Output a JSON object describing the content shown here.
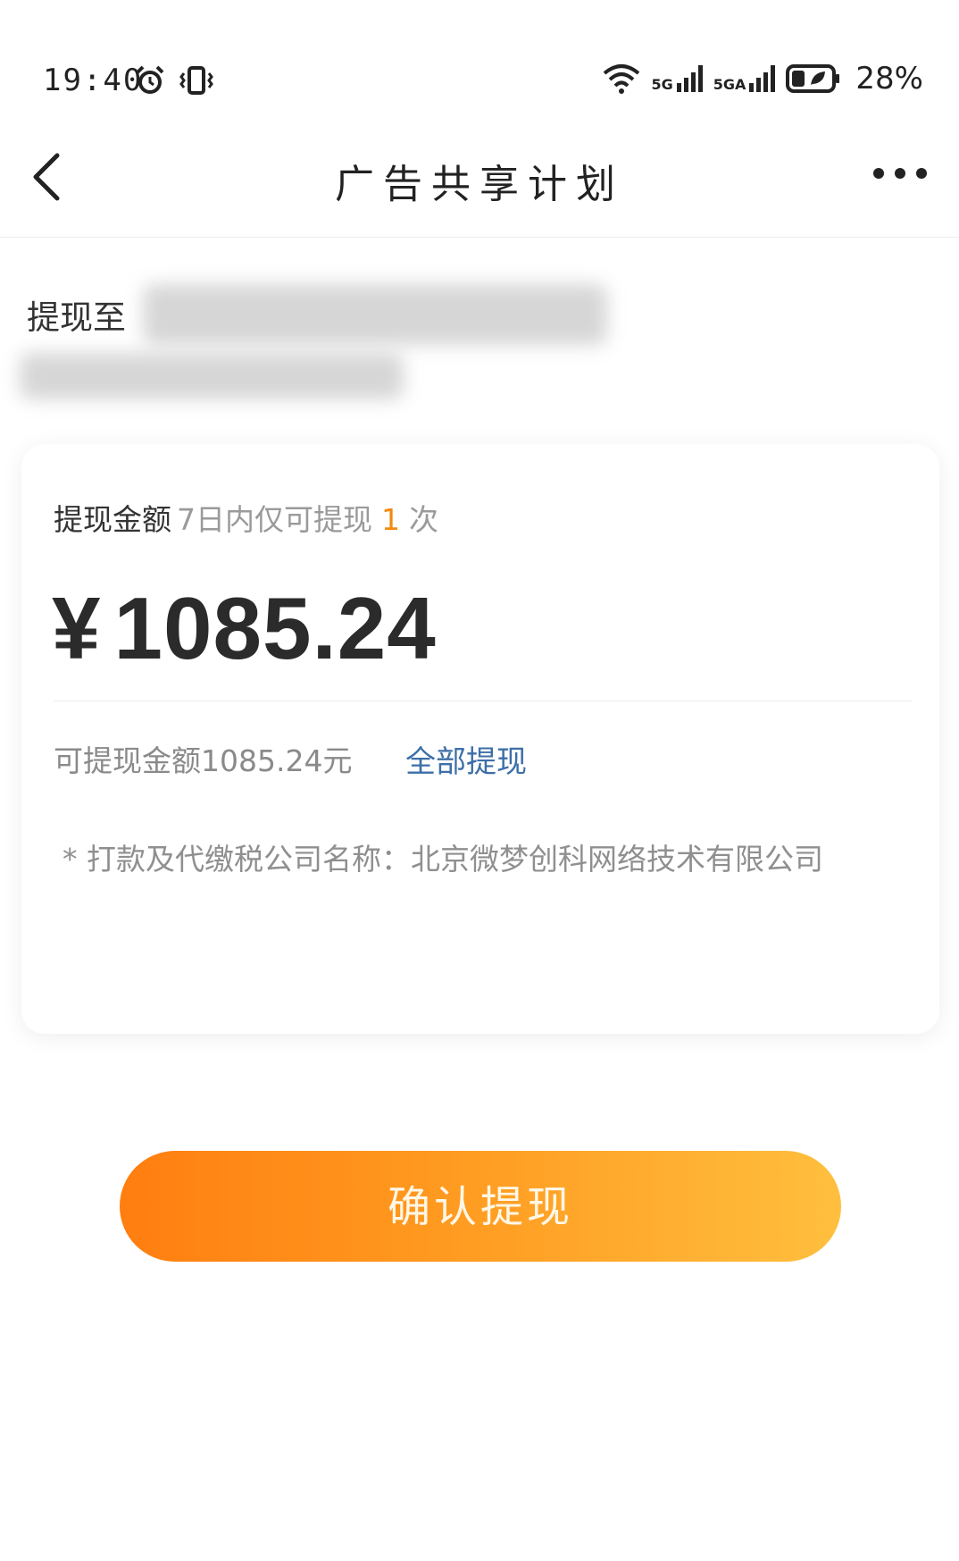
{
  "status_bar": {
    "time": "19:40",
    "network_1": "5G",
    "network_2": "5GA",
    "battery": "28%"
  },
  "nav": {
    "title": "广告共享计划"
  },
  "withdraw_to": {
    "label": "提现至"
  },
  "card": {
    "amount_label": "提现金额",
    "limit_prefix": "7日内仅可提现",
    "limit_count": "1",
    "limit_suffix": "次",
    "currency_symbol": "¥",
    "amount": "1085.24",
    "available_text": "可提现金额1085.24元",
    "withdraw_all_label": "全部提现",
    "company_note": "* 打款及代缴税公司名称：北京微梦创科网络技术有限公司"
  },
  "confirm_button": {
    "label": "确认提现"
  },
  "colors": {
    "accent_orange": "#f08a12",
    "link_blue": "#3d6fa8",
    "button_gradient_start": "#ff7e10",
    "button_gradient_end": "#ffbf3e"
  }
}
